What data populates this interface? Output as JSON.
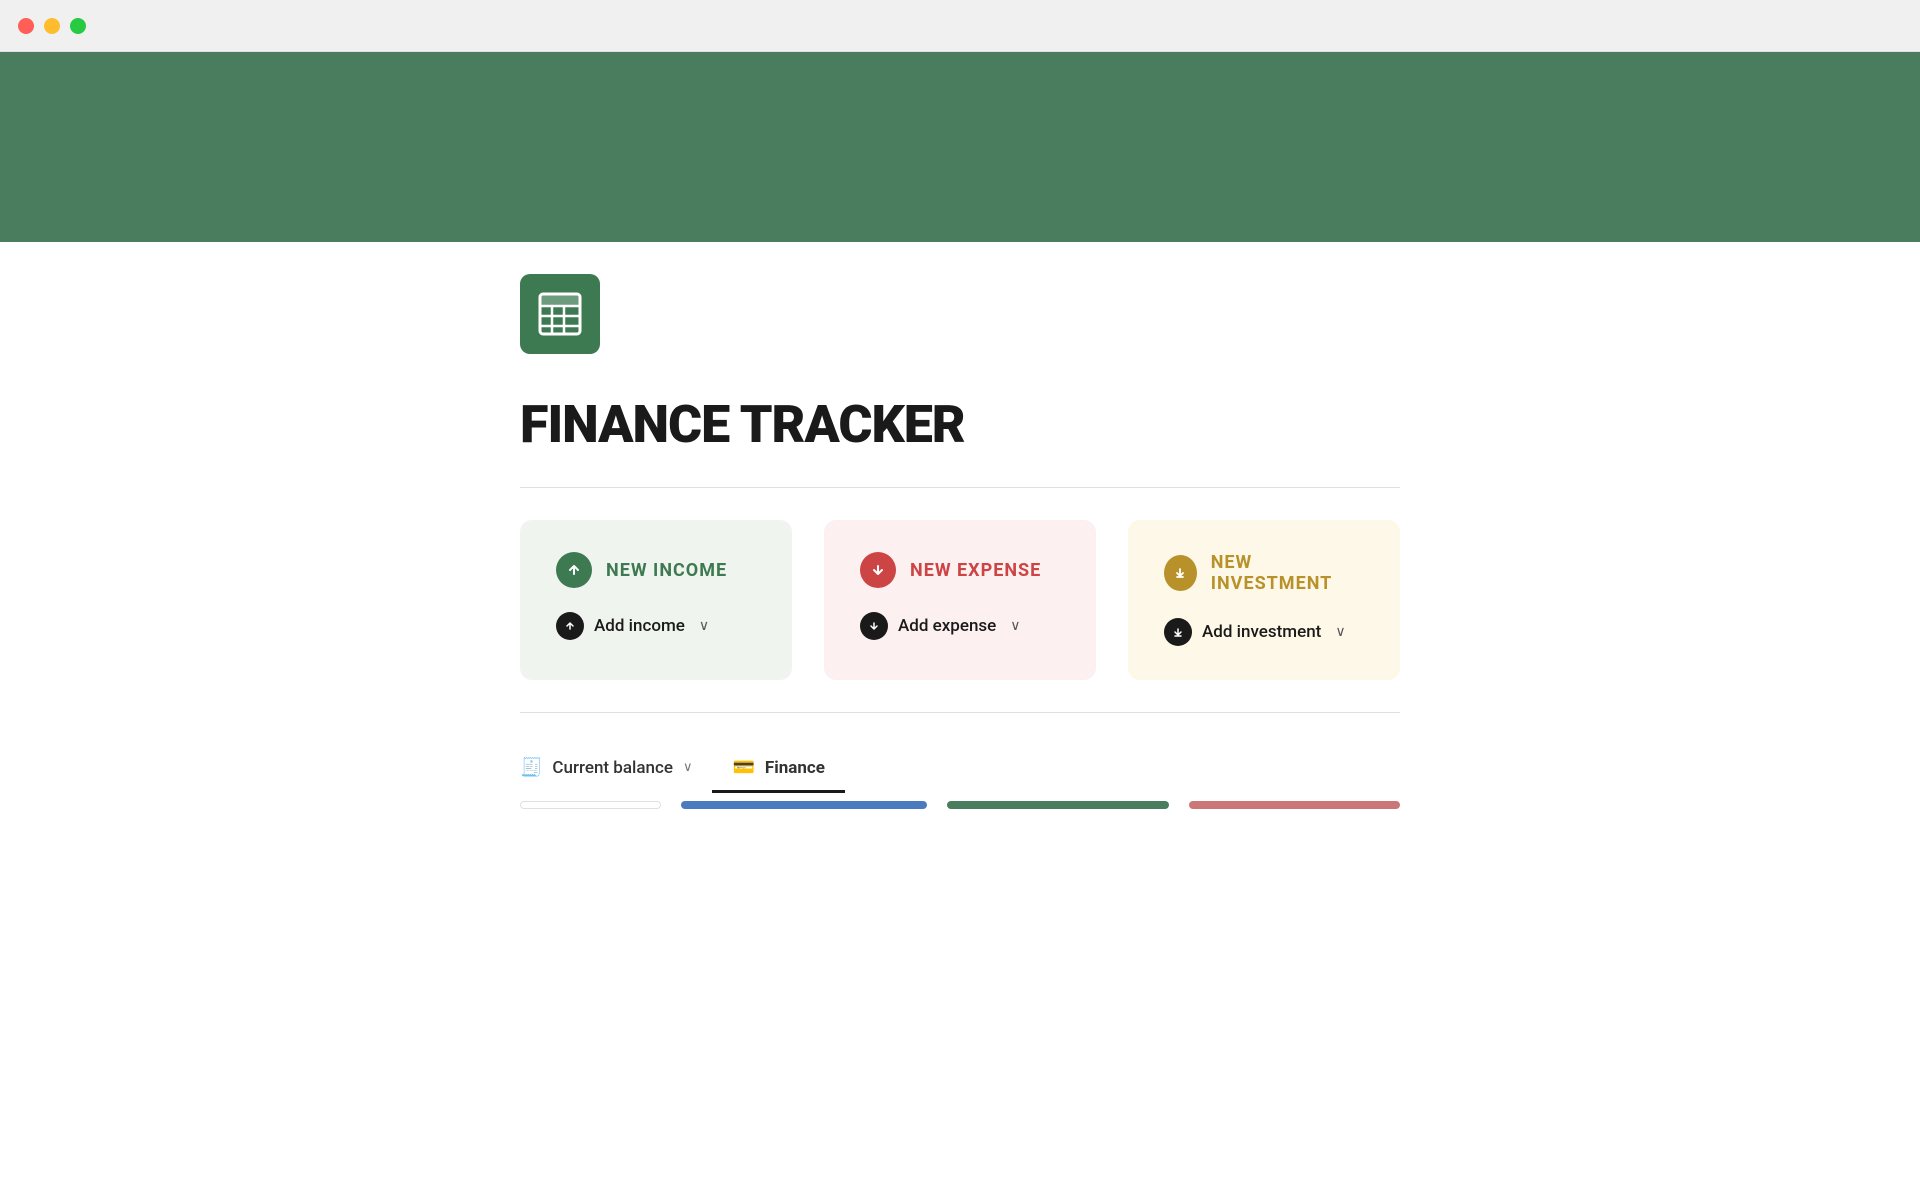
{
  "titleBar": {
    "buttons": {
      "close": "close",
      "minimize": "minimize",
      "maximize": "maximize"
    }
  },
  "header": {
    "bannerColor": "#4a7c5e"
  },
  "page": {
    "icon": "spreadsheet-icon",
    "title": "FINANCE TRACKER"
  },
  "cards": [
    {
      "id": "income",
      "title": "NEW INCOME",
      "actionLabel": "Add income",
      "bgColor": "#f0f4ee",
      "titleColor": "#3d7a52",
      "iconSymbol": "↑",
      "actionIconSymbol": "↑"
    },
    {
      "id": "expense",
      "title": "NEW EXPENSE",
      "actionLabel": "Add expense",
      "bgColor": "#fdf0f0",
      "titleColor": "#cc4444",
      "iconSymbol": "↓",
      "actionIconSymbol": "↓"
    },
    {
      "id": "investment",
      "title": "NEW INVESTMENT",
      "actionLabel": "Add investment",
      "bgColor": "#fdf8e8",
      "titleColor": "#b8912a",
      "iconSymbol": "⬇",
      "actionIconSymbol": "⬇"
    }
  ],
  "tabs": [
    {
      "id": "current-balance",
      "label": "Current balance",
      "icon": "balance-icon",
      "iconSymbol": "🧾",
      "active": false,
      "hasChevron": true
    },
    {
      "id": "finance",
      "label": "Finance",
      "icon": "finance-icon",
      "iconSymbol": "💳",
      "active": true,
      "hasChevron": false
    }
  ]
}
